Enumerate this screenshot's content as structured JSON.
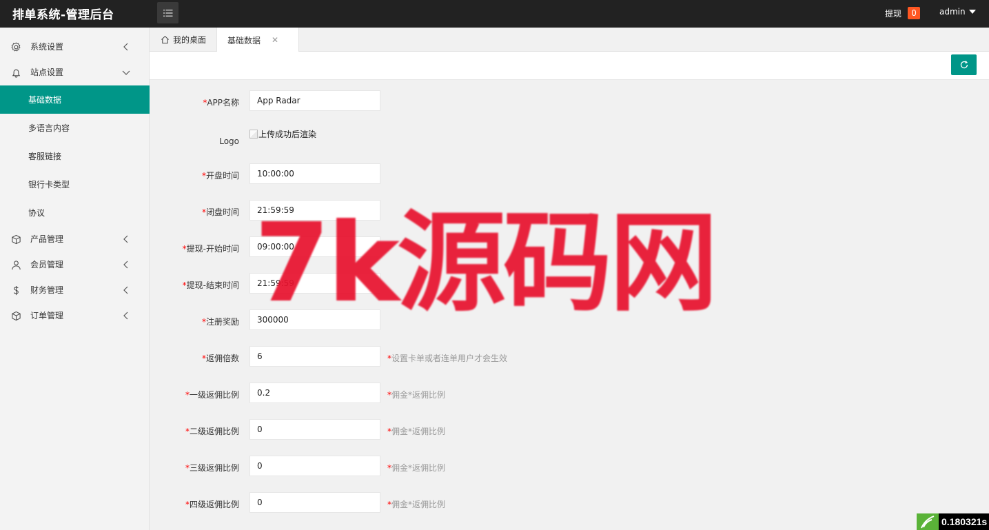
{
  "header": {
    "app_title": "排单系统-管理后台",
    "withdraw_label": "提现",
    "withdraw_count": "0",
    "user_name": "admin"
  },
  "sidebar": {
    "items": [
      {
        "label": "系统设置",
        "icon": "gear-icon",
        "state": "collapsed"
      },
      {
        "label": "站点设置",
        "icon": "bell-icon",
        "state": "expanded"
      },
      {
        "label": "产品管理",
        "icon": "cube-icon",
        "state": "collapsed"
      },
      {
        "label": "会员管理",
        "icon": "user-icon",
        "state": "collapsed"
      },
      {
        "label": "财务管理",
        "icon": "dollar-icon",
        "state": "collapsed"
      },
      {
        "label": "订单管理",
        "icon": "cube-icon",
        "state": "collapsed"
      }
    ],
    "subitems": [
      {
        "label": "基础数据",
        "active": true
      },
      {
        "label": "多语言内容",
        "active": false
      },
      {
        "label": "客服链接",
        "active": false
      },
      {
        "label": "银行卡类型",
        "active": false
      },
      {
        "label": "协议",
        "active": false
      }
    ]
  },
  "tabs": [
    {
      "label": "我的桌面",
      "icon": "home-icon"
    },
    {
      "label": "基础数据",
      "close": "✕",
      "active": true
    }
  ],
  "form": {
    "required_mark": "*",
    "fields": [
      {
        "label": "APP名称",
        "value": "App Radar",
        "required": true
      },
      {
        "label": "Logo",
        "alt": "上传成功后渲染",
        "required": false
      },
      {
        "label": "开盘时间",
        "value": "10:00:00",
        "required": true
      },
      {
        "label": "闭盘时间",
        "value": "21:59:59",
        "required": true
      },
      {
        "label": "提现-开始时间",
        "value": "09:00:00",
        "required": true
      },
      {
        "label": "提现-结束时间",
        "value": "21:59:59",
        "required": true
      },
      {
        "label": "注册奖励",
        "value": "300000",
        "required": true
      },
      {
        "label": "返佣倍数",
        "value": "6",
        "required": true,
        "hint": "设置卡单或者连单用户才会生效"
      },
      {
        "label": "一级返佣比例",
        "value": "0.2",
        "required": true,
        "hint": "佣金*返佣比例"
      },
      {
        "label": "二级返佣比例",
        "value": "0",
        "required": true,
        "hint": "佣金*返佣比例"
      },
      {
        "label": "三级返佣比例",
        "value": "0",
        "required": true,
        "hint": "佣金*返佣比例"
      },
      {
        "label": "四级返佣比例",
        "value": "0",
        "required": true,
        "hint": "佣金*返佣比例"
      }
    ]
  },
  "watermark": {
    "text": "7k源码网",
    "color": "#e8112d"
  },
  "timer": {
    "value": "0.180321s"
  },
  "colors": {
    "accent": "#009688",
    "header": "#222222",
    "badge": "#ff5722"
  }
}
